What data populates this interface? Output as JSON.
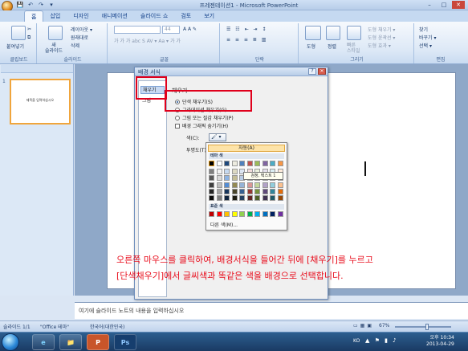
{
  "window": {
    "title": "프레젠테이션1 - Microsoft PowerPoint",
    "controls": [
      "–",
      "□",
      "✕"
    ]
  },
  "quick_access": [
    "💾",
    "↶",
    "↷",
    "▾"
  ],
  "tabs": [
    "홈",
    "삽입",
    "디자인",
    "애니메이션",
    "슬라이드 쇼",
    "검토",
    "보기"
  ],
  "ribbon": {
    "clipboard": {
      "label": "클립보드",
      "paste": "붙여넣기"
    },
    "slides": {
      "label": "슬라이드",
      "new_slide": "새\n슬라이드",
      "layout": "레이아웃 ▾",
      "reset": "원래대로",
      "delete": "삭제"
    },
    "font": {
      "label": "글꼴",
      "size": "44",
      "buttons": "가  가  가  abc  S  AV ▾  Aa ▾  가  가"
    },
    "paragraph": {
      "label": "단락"
    },
    "drawing": {
      "label": "그리기",
      "shapes": "도형",
      "arrange": "정렬",
      "quick_styles": "빠른\n스타일",
      "fill": "도형 채우기 ▾",
      "outline": "도형 윤곽선 ▾",
      "effects": "도형 효과 ▾"
    },
    "editing": {
      "label": "편집",
      "find": "찾기",
      "replace": "바꾸기 ▾",
      "select": "선택 ▾"
    }
  },
  "left_panel": {
    "slide_number": "1",
    "thumb_title": "제목을 입력하십시오"
  },
  "dialog": {
    "title": "배경 서식",
    "categories": [
      "채우기",
      "그림"
    ],
    "section_title": "채우기",
    "options": [
      {
        "label": "단색 채우기(S)",
        "type": "radio",
        "checked": true
      },
      {
        "label": "그라데이션 채우기(G)",
        "type": "radio",
        "checked": false
      },
      {
        "label": "그림 또는 질감 채우기(P)",
        "type": "radio",
        "checked": false
      },
      {
        "label": "배경 그래픽 숨기기(H)",
        "type": "check",
        "checked": false
      }
    ],
    "color_label": "색(C):",
    "transparency_label": "투명도(T):"
  },
  "palette": {
    "auto": "자동(A)",
    "theme_header": "테마 색",
    "standard_header": "표준 색",
    "more": "다른 색(M)...",
    "tooltip": "검정, 텍스트 1",
    "theme_top": [
      "#000000",
      "#ffffff",
      "#1f497d",
      "#eeece1",
      "#4f81bd",
      "#c0504d",
      "#9bbb59",
      "#8064a2",
      "#4bacc6",
      "#f79646"
    ],
    "theme_columns": [
      [
        "#7f7f7f",
        "#595959",
        "#3f3f3f",
        "#262626",
        "#0c0c0c"
      ],
      [
        "#f2f2f2",
        "#d8d8d8",
        "#bfbfbf",
        "#a5a5a5",
        "#7f7f7f"
      ],
      [
        "#c6d9f0",
        "#8db3e2",
        "#548dd4",
        "#17365d",
        "#0f243e"
      ],
      [
        "#ddd9c3",
        "#c4bd97",
        "#938953",
        "#494429",
        "#1d1b10"
      ],
      [
        "#dbe5f1",
        "#b8cce4",
        "#95b3d7",
        "#366092",
        "#244061"
      ],
      [
        "#f2dcdb",
        "#e5b9b7",
        "#d99694",
        "#953734",
        "#632423"
      ],
      [
        "#ebf1dd",
        "#d7e3bc",
        "#c3d69b",
        "#76923c",
        "#4f6128"
      ],
      [
        "#e5e0ec",
        "#ccc1d9",
        "#b2a2c7",
        "#5f497a",
        "#3f3151"
      ],
      [
        "#dbeef3",
        "#b7dde8",
        "#92cddc",
        "#31859b",
        "#205867"
      ],
      [
        "#fdeada",
        "#fbd5b5",
        "#fac08f",
        "#e36c09",
        "#974806"
      ]
    ],
    "standard": [
      "#c00000",
      "#ff0000",
      "#ffc000",
      "#ffff00",
      "#92d050",
      "#00b050",
      "#00b0f0",
      "#0070c0",
      "#002060",
      "#7030a0"
    ]
  },
  "annotation": {
    "line1": "오른쪽 마우스를 클릭하여, 배경서식을 들어간 뒤에 [채우기]를 누르고",
    "line2": "[단색채우기]에서 글씨색과 똑같은 색을 배경으로 선택합니다."
  },
  "notes": {
    "placeholder": "여기에 슬라이드 노트의 내용을 입력하십시오"
  },
  "status_bar": {
    "slide": "슬라이드 1/1",
    "theme": "\"Office 테마\"",
    "language": "한국어(대한민국)",
    "zoom": "67%"
  },
  "taskbar": {
    "apps": [
      "e",
      "📁",
      "P",
      "Ps"
    ],
    "time": "오후 10:34",
    "date": "2013-04-29",
    "ime": "KO"
  }
}
